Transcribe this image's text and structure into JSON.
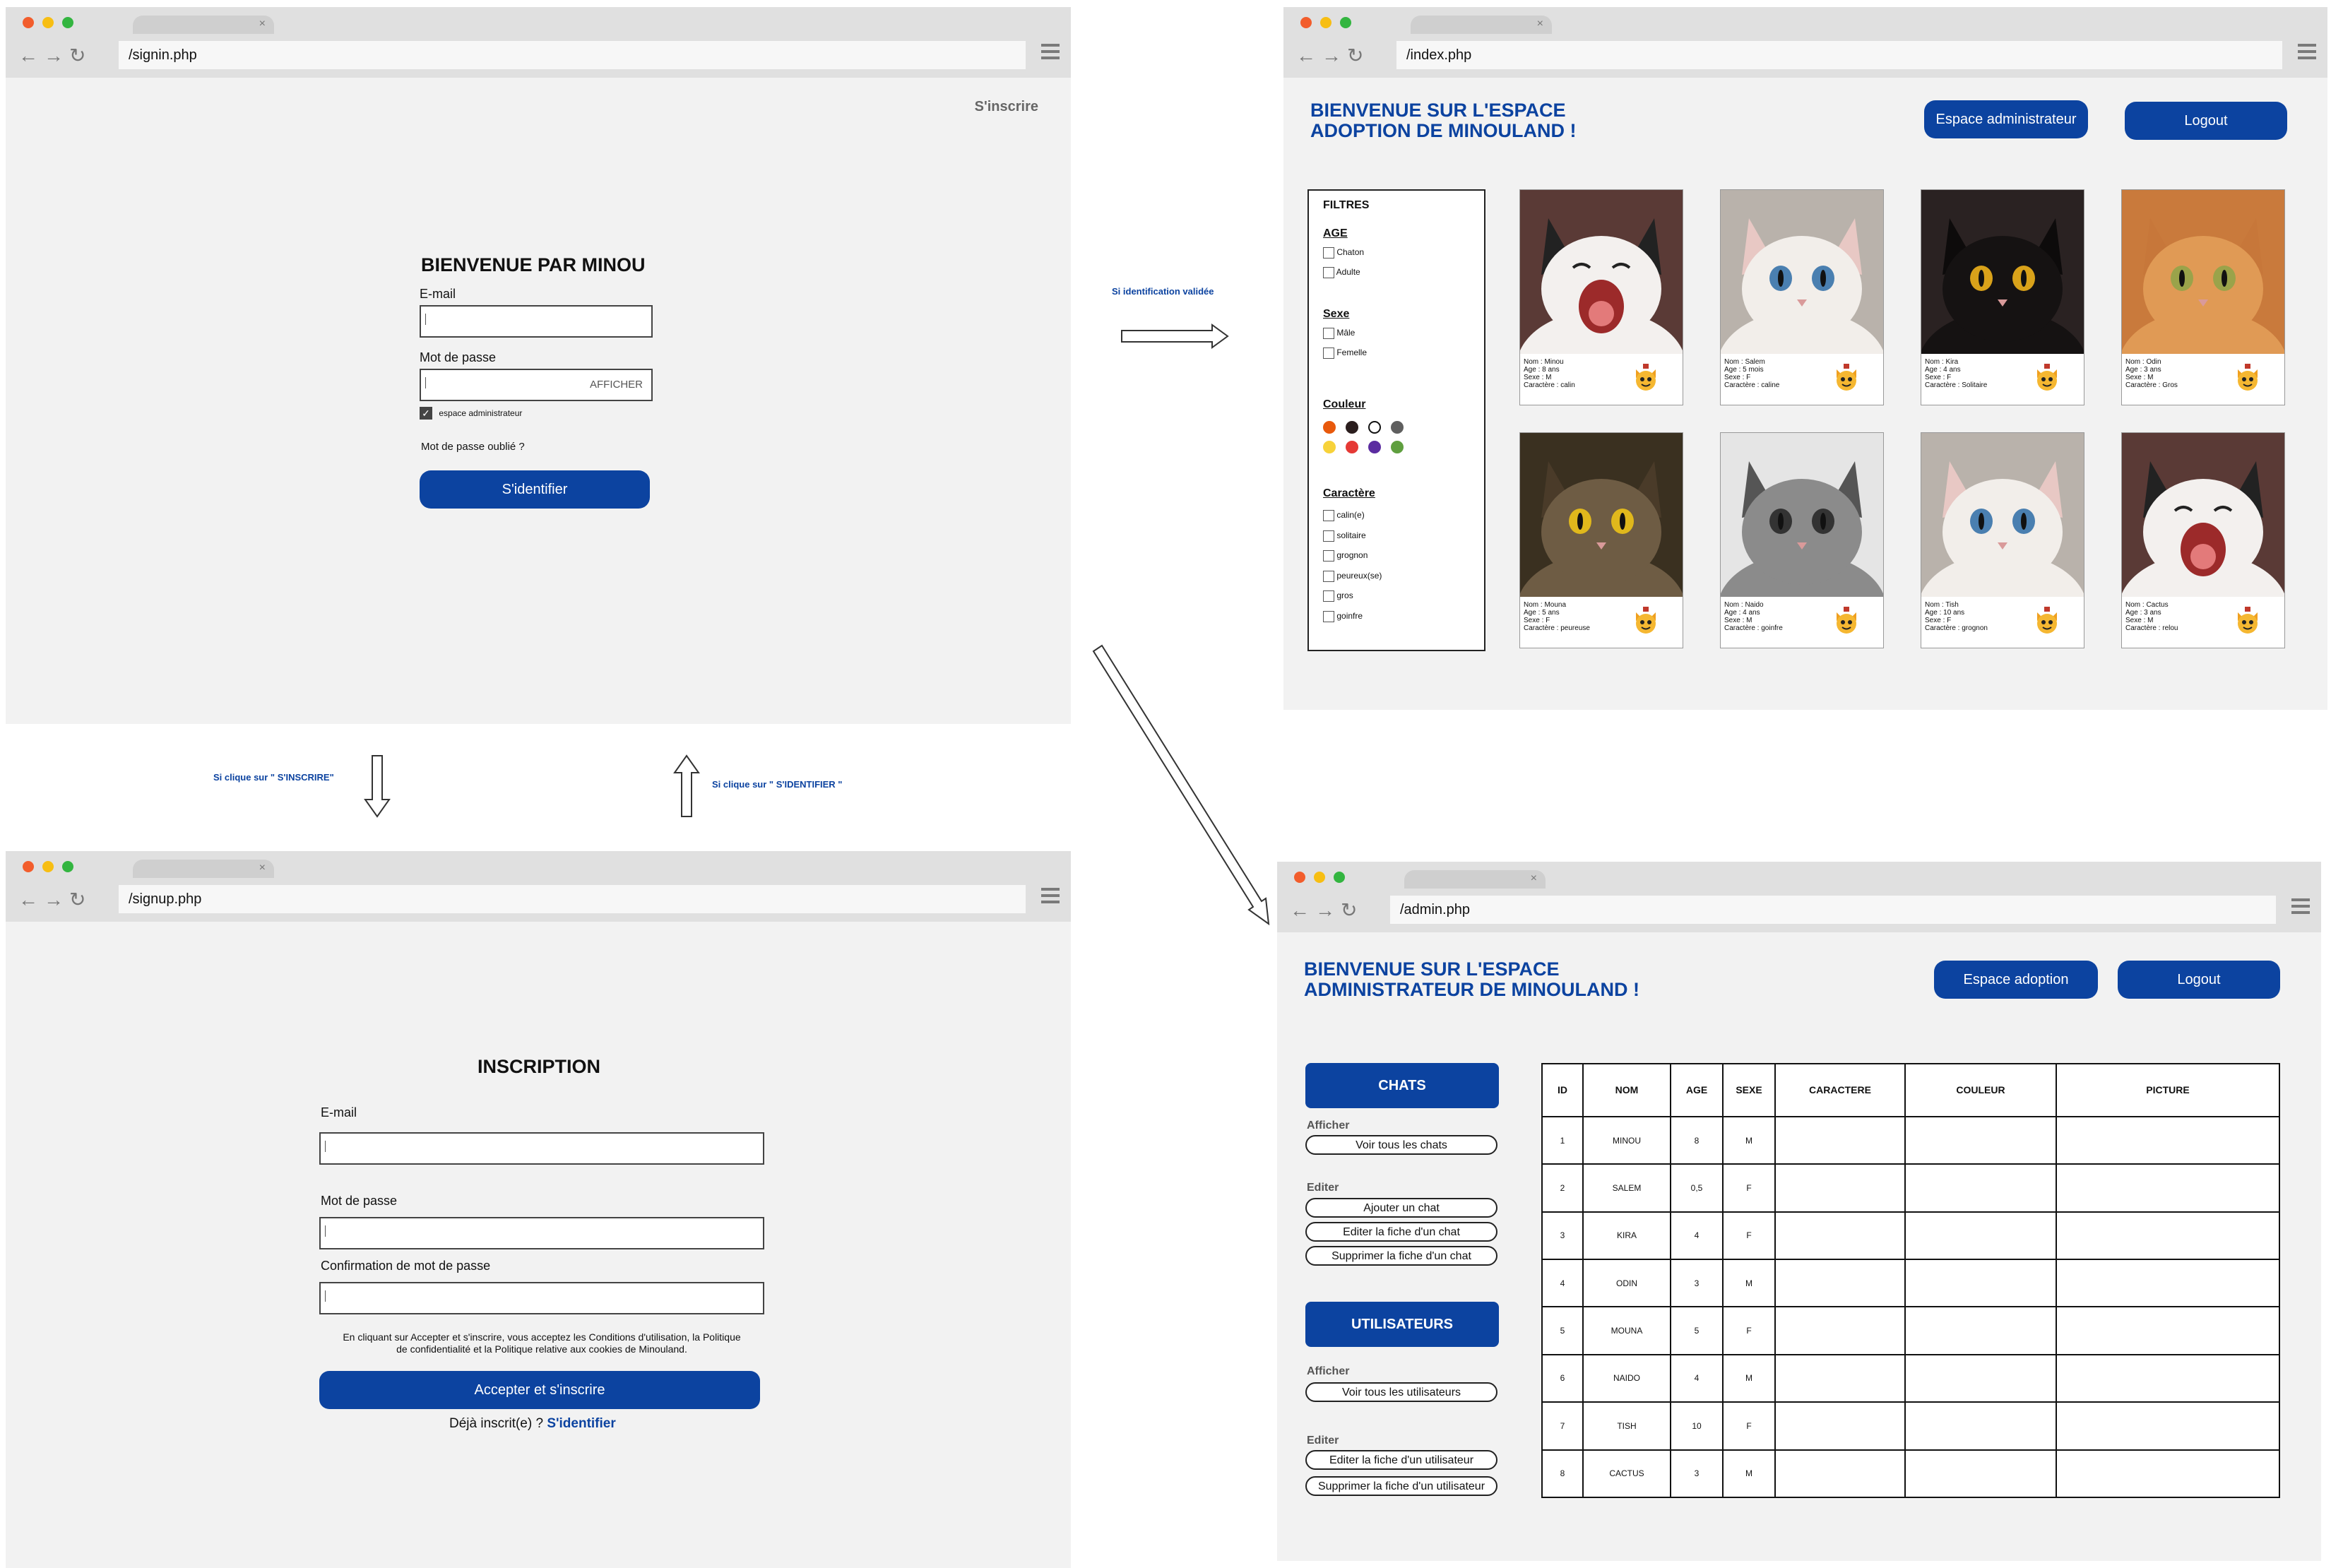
{
  "signin": {
    "url": "/signin.php",
    "register_link": "S'inscrire",
    "title": "BIENVENUE PAR MINOU",
    "email_label": "E-mail",
    "password_label": "Mot de passe",
    "show_button": "AFFICHER",
    "admin_checkbox": "espace administrateur",
    "forgot": "Mot de passe oublié ?",
    "submit": "S'identifier"
  },
  "signup": {
    "url": "/signup.php",
    "title": "INSCRIPTION",
    "email_label": "E-mail",
    "password_label": "Mot de passe",
    "confirm_label": "Confirmation de mot de passe",
    "terms_line1": "En cliquant sur Accepter et s'inscrire, vous acceptez les Conditions d'utilisation, la Politique",
    "terms_line2": "de confidentialité et la Politique relative aux cookies de Minouland.",
    "submit": "Accepter et s'inscrire",
    "already": "Déjà inscrit(e) ? ",
    "login_link": "S'identifier"
  },
  "index": {
    "url": "/index.php",
    "title_line1": "BIENVENUE SUR L'ESPACE",
    "title_line2": "ADOPTION DE MINOULAND !",
    "admin_button": "Espace administrateur",
    "logout_button": "Logout",
    "filters": {
      "title": "FILTRES",
      "age_title": "AGE",
      "age_options": [
        "Chaton",
        "Adulte"
      ],
      "sexe_title": "Sexe",
      "sexe_options": [
        "Mâle",
        "Femelle"
      ],
      "couleur_title": "Couleur",
      "colors_row1": [
        "#e8590c",
        "#2b1e1e",
        "#ffffff",
        "#5f5f5f"
      ],
      "colors_row2": [
        "#f7d23a",
        "#e53935",
        "#5b2ca0",
        "#5f9f3f"
      ],
      "caractere_title": "Caractère",
      "caractere_options": [
        "calin(e)",
        "solitaire",
        "grognon",
        "peureux(se)",
        "gros",
        "goinfre"
      ]
    },
    "cats": [
      {
        "nom": "Nom : Minou",
        "age": "Age : 8 ans",
        "sexe": "Sexe : M",
        "caractere": "Caractère : calin",
        "photo": "yawning-kitten"
      },
      {
        "nom": "Nom : Salem",
        "age": "Age : 5 mois",
        "sexe": "Sexe : F",
        "caractere": "Caractère : caline",
        "photo": "white-kitten"
      },
      {
        "nom": "Nom : Kira",
        "age": "Age : 4 ans",
        "sexe": "Sexe : F",
        "caractere": "Caractère : Solitaire",
        "photo": "black-cat"
      },
      {
        "nom": "Nom : Odin",
        "age": "Age : 3 ans",
        "sexe": "Sexe : M",
        "caractere": "Caractère : Gros",
        "photo": "orange-cat"
      },
      {
        "nom": "Nom : Mouna",
        "age": "Age : 5 ans",
        "sexe": "Sexe : F",
        "caractere": "Caractère : peureuse",
        "photo": "tabby-cat"
      },
      {
        "nom": "Nom : Naido",
        "age": "Age : 4 ans",
        "sexe": "Sexe : M",
        "caractere": "Caractère : goinfre",
        "photo": "grey-tabby"
      },
      {
        "nom": "Nom : Tish",
        "age": "Age : 10 ans",
        "sexe": "Sexe : F",
        "caractere": "Caractère : grognon",
        "photo": "white-kitten"
      },
      {
        "nom": "Nom : Cactus",
        "age": "Age : 3 ans",
        "sexe": "Sexe : M",
        "caractere": "Caractère : relou",
        "photo": "yawning-kitten"
      }
    ]
  },
  "admin": {
    "url": "/admin.php",
    "title_line1": "BIENVENUE SUR L'ESPACE",
    "title_line2": "ADMINISTRATEUR DE MINOULAND !",
    "adoption_button": "Espace adoption",
    "logout_button": "Logout",
    "chats_header": "CHATS",
    "afficher_label": "Afficher",
    "voir_chats": "Voir tous les chats",
    "editer_label": "Editer",
    "ajouter_chat": "Ajouter un chat",
    "editer_chat": "Editer la fiche d'un chat",
    "supprimer_chat": "Supprimer la fiche d'un chat",
    "users_header": "UTILISATEURS",
    "afficher_label2": "Afficher",
    "voir_users": "Voir tous les utilisateurs",
    "editer_label2": "Editer",
    "editer_user": "Editer la fiche d'un utilisateur",
    "supprimer_user": "Supprimer la fiche d'un utilisateur",
    "table_headers": [
      "ID",
      "NOM",
      "AGE",
      "SEXE",
      "CARACTERE",
      "COULEUR",
      "PICTURE"
    ],
    "table_rows": [
      [
        "1",
        "MINOU",
        "8",
        "M"
      ],
      [
        "2",
        "SALEM",
        "0,5",
        "F"
      ],
      [
        "3",
        "KIRA",
        "4",
        "F"
      ],
      [
        "4",
        "ODIN",
        "3",
        "M"
      ],
      [
        "5",
        "MOUNA",
        "5",
        "F"
      ],
      [
        "6",
        "NAIDO",
        "4",
        "M"
      ],
      [
        "7",
        "TISH",
        "10",
        "F"
      ],
      [
        "8",
        "CACTUS",
        "3",
        "M"
      ]
    ]
  },
  "annotations": {
    "to_signup": "Si clique sur \" S'INSCRIRE\"",
    "to_signin": "Si clique sur \" S'IDENTIFIER \"",
    "validated": "Si identification validée"
  },
  "colors": {
    "accent": "#0c43a0",
    "chrome": "#e0e0e0",
    "page": "#f2f2f2"
  }
}
